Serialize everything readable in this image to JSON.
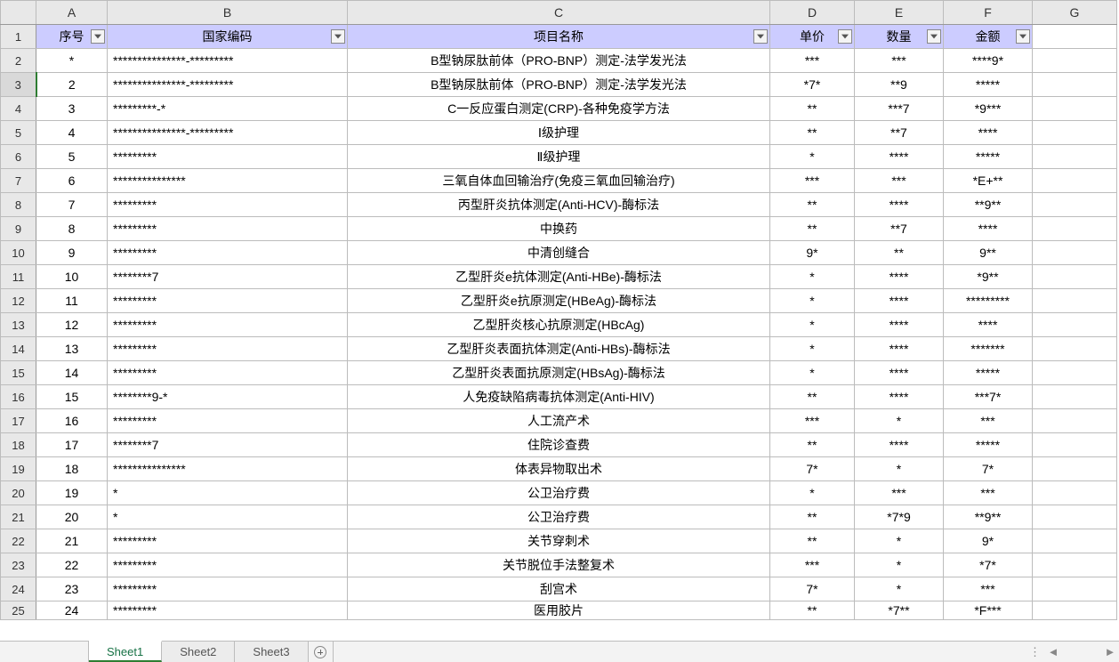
{
  "col_letters": [
    "A",
    "B",
    "C",
    "D",
    "E",
    "F",
    "G"
  ],
  "row_numbers": [
    1,
    2,
    3,
    4,
    5,
    6,
    7,
    8,
    9,
    10,
    11,
    12,
    13,
    14,
    15,
    16,
    17,
    18,
    19,
    20,
    21,
    22,
    23,
    24,
    25
  ],
  "selected_row": 3,
  "header_row": {
    "A": "序号",
    "B": "国家编码",
    "C": "项目名称",
    "D": "单价",
    "E": "数量",
    "F": "金额"
  },
  "rows": [
    {
      "A": "*",
      "B": "***************-*********",
      "C": "B型钠尿肽前体（PRO-BNP）测定-法学发光法",
      "D": "***",
      "E": "***",
      "F": "****9*"
    },
    {
      "A": "2",
      "B": "***************-*********",
      "C": "B型钠尿肽前体（PRO-BNP）测定-法学发光法",
      "D": "*7*",
      "E": "**9",
      "F": "*****"
    },
    {
      "A": "3",
      "B": "*********-*",
      "C": "C一反应蛋白测定(CRP)-各种免疫学方法",
      "D": "**",
      "E": "***7",
      "F": "*9***"
    },
    {
      "A": "4",
      "B": "***************-*********",
      "C": "Ⅰ级护理",
      "D": "**",
      "E": "**7",
      "F": "****"
    },
    {
      "A": "5",
      "B": "*********",
      "C": "Ⅱ级护理",
      "D": "*",
      "E": "****",
      "F": "*****"
    },
    {
      "A": "6",
      "B": "***************",
      "C": "三氧自体血回输治疗(免疫三氧血回输治疗)",
      "D": "***",
      "E": "***",
      "F": "*E+**"
    },
    {
      "A": "7",
      "B": "*********",
      "C": "丙型肝炎抗体测定(Anti-HCV)-酶标法",
      "D": "**",
      "E": "****",
      "F": "**9**"
    },
    {
      "A": "8",
      "B": "*********",
      "C": "中换药",
      "D": "**",
      "E": "**7",
      "F": "****"
    },
    {
      "A": "9",
      "B": "*********",
      "C": "中清创缝合",
      "D": "9*",
      "E": "**",
      "F": "9**"
    },
    {
      "A": "10",
      "B": "********7",
      "C": "乙型肝炎e抗体测定(Anti-HBe)-酶标法",
      "D": "*",
      "E": "****",
      "F": "*9**"
    },
    {
      "A": "11",
      "B": "*********",
      "C": "乙型肝炎e抗原测定(HBeAg)-酶标法",
      "D": "*",
      "E": "****",
      "F": "*********"
    },
    {
      "A": "12",
      "B": "*********",
      "C": "乙型肝炎核心抗原测定(HBcAg)",
      "D": "*",
      "E": "****",
      "F": "****"
    },
    {
      "A": "13",
      "B": "*********",
      "C": "乙型肝炎表面抗体测定(Anti-HBs)-酶标法",
      "D": "*",
      "E": "****",
      "F": "*******"
    },
    {
      "A": "14",
      "B": "*********",
      "C": "乙型肝炎表面抗原测定(HBsAg)-酶标法",
      "D": "*",
      "E": "****",
      "F": "*****"
    },
    {
      "A": "15",
      "B": "********9-*",
      "C": "人免疫缺陷病毒抗体测定(Anti-HIV)",
      "D": "**",
      "E": "****",
      "F": "***7*"
    },
    {
      "A": "16",
      "B": "*********",
      "C": "人工流产术",
      "D": "***",
      "E": "*",
      "F": "***"
    },
    {
      "A": "17",
      "B": "********7",
      "C": "住院诊查费",
      "D": "**",
      "E": "****",
      "F": "*****"
    },
    {
      "A": "18",
      "B": "***************",
      "C": "体表异物取出术",
      "D": "7*",
      "E": "*",
      "F": "7*"
    },
    {
      "A": "19",
      "B": "*",
      "C": "公卫治疗费",
      "D": "*",
      "E": "***",
      "F": "***"
    },
    {
      "A": "20",
      "B": "*",
      "C": "公卫治疗费",
      "D": "**",
      "E": "*7*9",
      "F": "**9**"
    },
    {
      "A": "21",
      "B": "*********",
      "C": "关节穿刺术",
      "D": "**",
      "E": "*",
      "F": "9*"
    },
    {
      "A": "22",
      "B": "*********",
      "C": "关节脱位手法整复术",
      "D": "***",
      "E": "*",
      "F": "*7*"
    },
    {
      "A": "23",
      "B": "*********",
      "C": "刮宫术",
      "D": "7*",
      "E": "*",
      "F": "***"
    },
    {
      "A": "24",
      "B": "*********",
      "C": "医用胶片",
      "D": "**",
      "E": "*7**",
      "F": "*F***"
    }
  ],
  "tabs": [
    "Sheet1",
    "Sheet2",
    "Sheet3"
  ],
  "active_tab": 0,
  "icons": {
    "filter_name": "filter-dropdown-icon"
  }
}
